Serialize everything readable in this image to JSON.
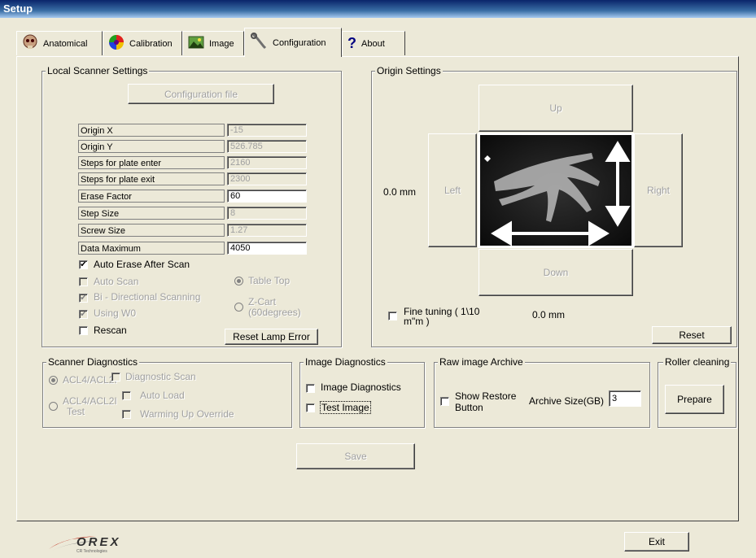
{
  "window": {
    "title": "Setup"
  },
  "tabs": [
    {
      "label": "Anatomical",
      "icon": "skull-icon"
    },
    {
      "label": "Calibration",
      "icon": "color-wheel-icon"
    },
    {
      "label": "Image",
      "icon": "image-icon"
    },
    {
      "label": "Configuration",
      "icon": "wrench-icon",
      "active": true
    },
    {
      "label": "About",
      "icon": "question-icon"
    }
  ],
  "local": {
    "title": "Local Scanner Settings",
    "config_button": "Configuration file",
    "rows": [
      {
        "label": "Origin X",
        "value": "-15",
        "enabled": false
      },
      {
        "label": "Origin Y",
        "value": "526.785",
        "enabled": false
      },
      {
        "label": "Steps for plate enter",
        "value": "2160",
        "enabled": false
      },
      {
        "label": "Steps for plate exit",
        "value": "2300",
        "enabled": false
      },
      {
        "label": "Erase Factor",
        "value": "60",
        "enabled": true
      },
      {
        "label": "Step Size",
        "value": "8",
        "enabled": false
      },
      {
        "label": "Screw Size",
        "value": "1.27",
        "enabled": false
      },
      {
        "label": "Data Maximum",
        "value": "4050",
        "enabled": true
      }
    ],
    "auto_erase": "Auto Erase After Scan",
    "auto_scan": "Auto Scan",
    "bidir": "Bi - Directional Scanning",
    "using_w0": "Using W0",
    "rescan": "Rescan",
    "table_top": "Table Top",
    "zcart": "Z-Cart",
    "zcart_sub": "(60degrees)",
    "reset_lamp": "Reset Lamp Error"
  },
  "origin": {
    "title": "Origin Settings",
    "up": "Up",
    "down": "Down",
    "left": "Left",
    "right": "Right",
    "x_offset": "0.0 mm",
    "y_offset": "0.0 mm",
    "fine_tuning": "Fine tuning  ( 1\\10",
    "fine_tuning2": "m\"m )",
    "reset": "Reset"
  },
  "diag": {
    "title": "Scanner Diagnostics",
    "acl1": "ACL4/ACL2I",
    "acl2": "ACL4/ACL2I",
    "acl2b": "Test",
    "diag_scan": "Diagnostic Scan",
    "auto_load": "Auto Load",
    "warming": "Warming Up Override"
  },
  "imgdiag": {
    "title": "Image Diagnostics",
    "cb1": "Image Diagnostics",
    "cb2": "Test Image"
  },
  "raw": {
    "title": "Raw image Archive",
    "show1": "Show Restore",
    "show2": "Button",
    "size_label": "Archive Size(GB)",
    "size_value": "3"
  },
  "roller": {
    "title": "Roller cleaning",
    "prepare": "Prepare"
  },
  "footer": {
    "save": "Save",
    "exit": "Exit",
    "logo": "OREX",
    "logo_sub": "CR Technologies"
  }
}
